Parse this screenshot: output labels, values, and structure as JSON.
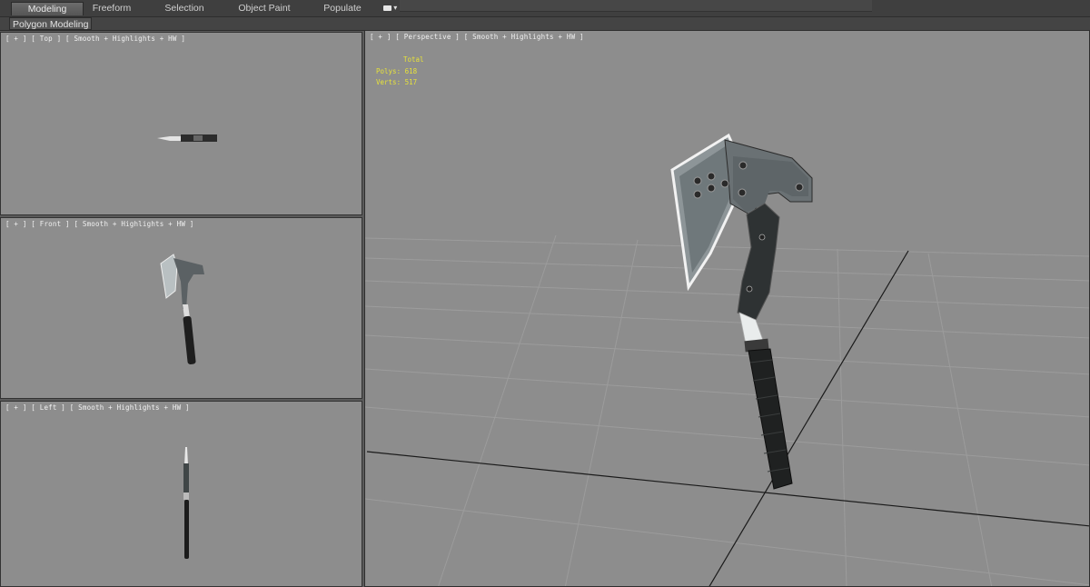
{
  "ribbon": {
    "tabs": [
      {
        "label": "Modeling",
        "active": true
      },
      {
        "label": "Freeform",
        "active": false
      },
      {
        "label": "Selection",
        "active": false
      },
      {
        "label": "Object Paint",
        "active": false
      },
      {
        "label": "Populate",
        "active": false
      }
    ],
    "dropdown_icon": "ribbon-options-icon",
    "panel_label": "Polygon Modeling"
  },
  "viewports": {
    "top": {
      "label": "[ + ] [ Top ] [ Smooth + Highlights + HW ]"
    },
    "front": {
      "label": "[ + ] [ Front ] [ Smooth + Highlights + HW ]"
    },
    "left": {
      "label": "[ + ] [ Left ] [ Smooth + Highlights + HW ]"
    },
    "perspective": {
      "label": "[ + ] [ Perspective ] [ Smooth + Highlights + HW ]",
      "stats": {
        "header": "Total",
        "polys": "Polys: 618",
        "verts": "Verts: 517"
      }
    }
  },
  "colors": {
    "viewport_bg": "#8d8d8d",
    "stats_text": "#e7e23a",
    "ribbon_bg": "#3f3f3f"
  }
}
